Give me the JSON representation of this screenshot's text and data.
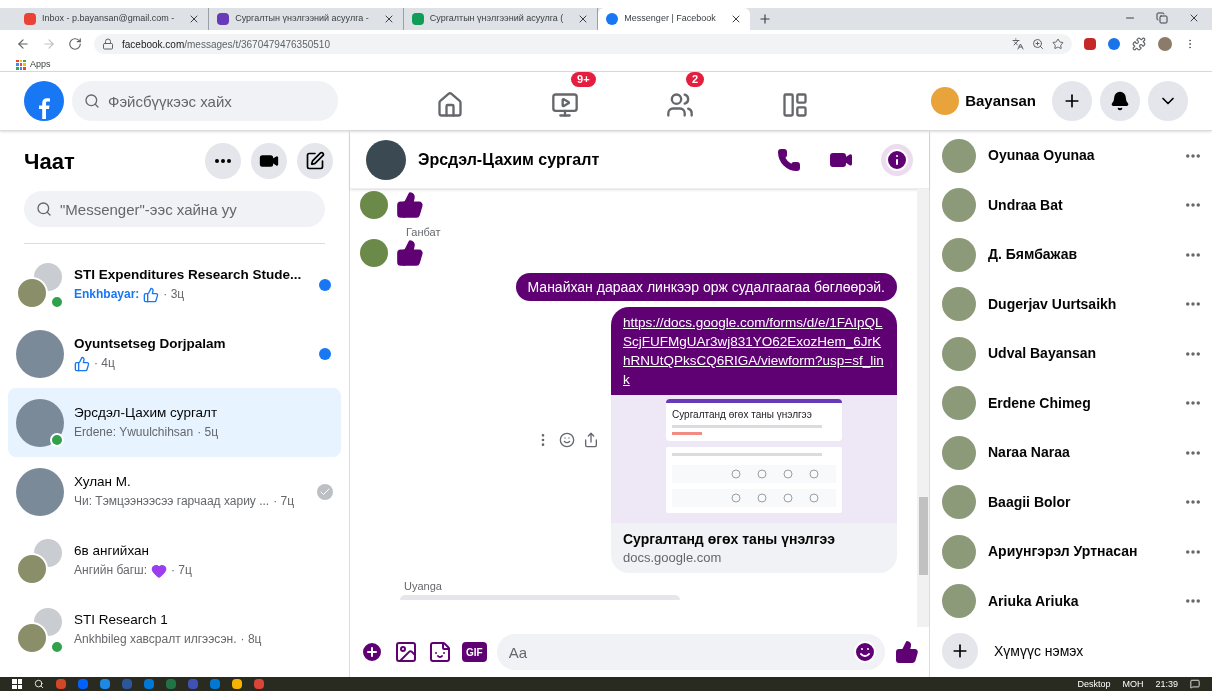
{
  "browser": {
    "tabs": [
      {
        "label": "Inbox - p.bayansan@gmail.com -",
        "selected": false
      },
      {
        "label": "Сургалтын үнэлгээний асуулга -",
        "selected": false
      },
      {
        "label": "Сургалтын үнэлгээний асуулга (",
        "selected": false
      },
      {
        "label": "Messenger | Facebook",
        "selected": true
      }
    ],
    "address": {
      "domain": "facebook.com",
      "path": "/messages/t/3670479476350510"
    },
    "bookmarks": [
      "Apps"
    ]
  },
  "header": {
    "search": {
      "placeholder": "Фэйсбүүкээс хайх"
    },
    "nav": [
      {
        "selected": false
      },
      {
        "badge": "9+",
        "selected": false
      },
      {
        "badge": "2",
        "selected": false
      },
      {
        "selected": false
      }
    ],
    "profile": "Bayansan"
  },
  "chats": {
    "title": "Чаат",
    "search": {
      "placeholder": "\"Messenger\"-ээс хайна уу"
    },
    "items": [
      {
        "name": "STI Expenditures Research Stude...",
        "parts": [
          {
            "kind": "text",
            "text": "Enkhbayar:"
          },
          {
            "kind": "like"
          }
        ],
        "time": "· 3ц",
        "unread": true,
        "seen": false,
        "online": true,
        "selected": false
      },
      {
        "name": "Oyuntsetseg Dorjpalam",
        "parts": [
          {
            "kind": "like"
          }
        ],
        "time": "· 4ц",
        "unread": true,
        "seen": false,
        "online": false,
        "selected": false
      },
      {
        "name": "Эрсдэл-Цахим сургалт",
        "parts": [
          {
            "kind": "text",
            "text": "Erdene: Ywuulchihsan"
          }
        ],
        "time": "· 5ц",
        "unread": false,
        "seen": false,
        "online": true,
        "selected": true
      },
      {
        "name": "Хулан М.",
        "parts": [
          {
            "kind": "text",
            "text": "Чи: Тэмцээнээсээ гарчаад хариу ..."
          }
        ],
        "time": "· 7ц",
        "unread": false,
        "seen": true,
        "online": false,
        "selected": false
      },
      {
        "name": "6в ангийхан",
        "parts": [
          {
            "kind": "text",
            "text": "Ангийн багш:"
          },
          {
            "kind": "heart"
          }
        ],
        "time": "· 7ц",
        "unread": false,
        "seen": false,
        "online": false,
        "selected": false
      },
      {
        "name": "STI Research 1",
        "parts": [
          {
            "kind": "text",
            "text": "Ankhbileg хавсралт илгээсэн."
          }
        ],
        "time": "· 8ц",
        "unread": false,
        "seen": false,
        "online": true,
        "selected": false
      }
    ]
  },
  "conversation": {
    "title": "Эрсдэл-Цахим сургалт",
    "messages": [
      {
        "kind": "like",
        "outgoing": false
      },
      {
        "kind": "like",
        "sender": "Ганбат",
        "outgoing": false
      },
      {
        "kind": "text",
        "text": "Манайхан дараах линкээр орж судалгаагаа бөглөөрэй.",
        "outgoing": true
      },
      {
        "kind": "link",
        "url": "https://docs.google.com/forms/d/e/1FAIpQLScjFUFMgUAr3wj831YO62ExozHem_6JrKhRNUtQPksCQ6RIGA/viewform?usp=sf_link",
        "preview_heading": "Сургалтанд өгөх таны үнэлгээ",
        "title": "Сургалтанд өгөх таны үнэлгээ",
        "domain": "docs.google.com",
        "outgoing": true
      },
      {
        "kind": "partial",
        "sender": "Uyanga",
        "outgoing": false
      }
    ],
    "composer": {
      "gif_label": "GIF",
      "placeholder": "Aa"
    }
  },
  "contacts": [
    {
      "name": "Oyunaa Oyunaa"
    },
    {
      "name": "Undraa Bat"
    },
    {
      "name": "Д. Бямбажав"
    },
    {
      "name": "Dugerjav Uurtsaikh"
    },
    {
      "name": "Udval Bayansan"
    },
    {
      "name": "Erdene Chimeg"
    },
    {
      "name": "Naraa Naraa"
    },
    {
      "name": "Baagii Bolor"
    },
    {
      "name": "Ариунгэрэл Уртнасан"
    },
    {
      "name": "Ariuka Ariuka"
    }
  ],
  "add_people": "Хүмүүс нэмэх",
  "taskbar": {
    "items": [
      "Desktop",
      "МОН",
      "21:39"
    ]
  }
}
